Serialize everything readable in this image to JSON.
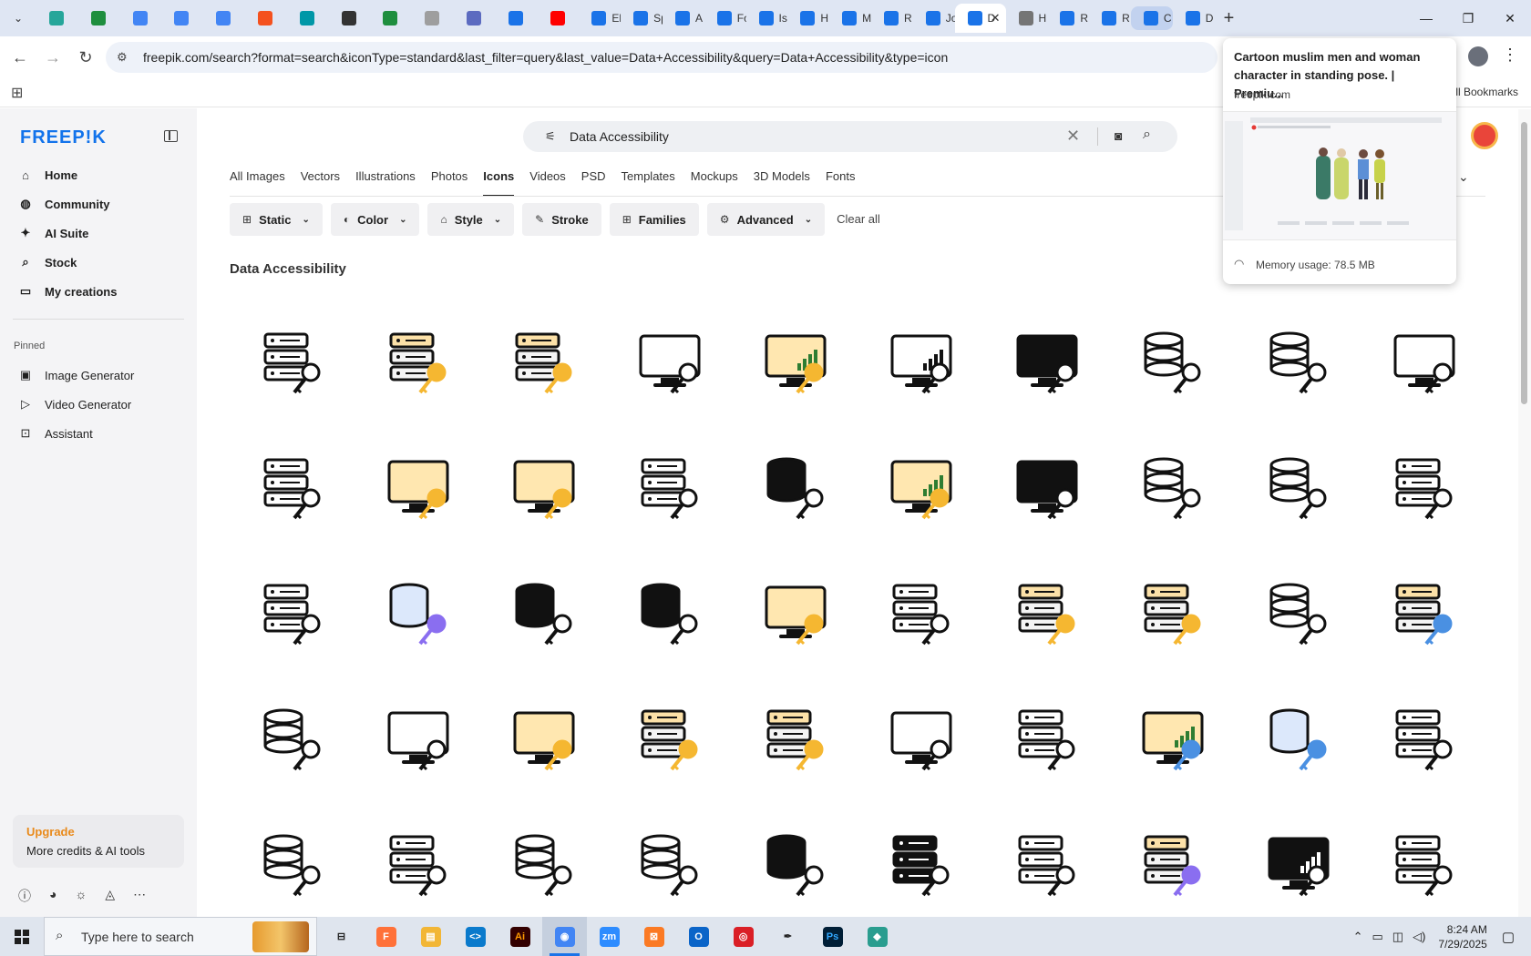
{
  "browser": {
    "tabs": [
      {
        "label": "",
        "color": "#26a69a"
      },
      {
        "label": "",
        "color": "#1e8e3e"
      },
      {
        "label": "",
        "color": "#4285f4"
      },
      {
        "label": "",
        "color": "#4285f4"
      },
      {
        "label": "",
        "color": "#4285f4"
      },
      {
        "label": "",
        "color": "#f4511e"
      },
      {
        "label": "",
        "color": "#0097a7"
      },
      {
        "label": "",
        "color": "#333333"
      },
      {
        "label": "",
        "color": "#1e8e3e"
      },
      {
        "label": "",
        "color": "#9e9e9e"
      },
      {
        "label": "",
        "color": "#5c6bc0"
      },
      {
        "label": "",
        "color": "#1a73e8"
      },
      {
        "label": "",
        "color": "#ff0000"
      },
      {
        "label": "El",
        "color": "#1a73e8"
      },
      {
        "label": "Sp",
        "color": "#1a73e8"
      },
      {
        "label": "A",
        "color": "#1a73e8"
      },
      {
        "label": "Fo",
        "color": "#1a73e8"
      },
      {
        "label": "Is",
        "color": "#1a73e8"
      },
      {
        "label": "H",
        "color": "#1a73e8"
      },
      {
        "label": "M",
        "color": "#1a73e8"
      },
      {
        "label": "R",
        "color": "#1a73e8"
      },
      {
        "label": "Jo",
        "color": "#1a73e8"
      },
      {
        "label": "D",
        "color": "#1a73e8",
        "active": true
      },
      {
        "label": "H",
        "color": "#757575"
      },
      {
        "label": "R",
        "color": "#1a73e8"
      },
      {
        "label": "R",
        "color": "#1a73e8"
      },
      {
        "label": "C",
        "color": "#1a73e8",
        "highlight": true
      },
      {
        "label": "D",
        "color": "#1a73e8"
      }
    ],
    "url": "freepik.com/search?format=search&iconType=standard&last_filter=query&last_value=Data+Accessibility&query=Data+Accessibility&type=icon",
    "all_bookmarks": "All Bookmarks",
    "hover_card": {
      "title": "Cartoon muslim men and woman character in standing pose. | Premiu...",
      "domain": "freepik.com",
      "memory": "Memory usage: 78.5 MB"
    }
  },
  "sidebar": {
    "logo": "FREEP!K",
    "items": [
      {
        "label": "Home",
        "icon": "home-icon",
        "glyph": "⌂"
      },
      {
        "label": "Community",
        "icon": "globe-icon",
        "glyph": "◍"
      },
      {
        "label": "AI Suite",
        "icon": "sparkle-icon",
        "glyph": "✦"
      },
      {
        "label": "Stock",
        "icon": "search-icon",
        "glyph": "⌕"
      },
      {
        "label": "My creations",
        "icon": "folder-icon",
        "glyph": "▭"
      }
    ],
    "pinned_label": "Pinned",
    "pinned": [
      {
        "label": "Image Generator",
        "icon": "image-icon",
        "glyph": "▣"
      },
      {
        "label": "Video Generator",
        "icon": "video-icon",
        "glyph": "▷"
      },
      {
        "label": "Assistant",
        "icon": "chat-icon",
        "glyph": "⊡"
      }
    ],
    "upgrade": {
      "title": "Upgrade",
      "subtitle": "More credits & AI tools"
    }
  },
  "search": {
    "query": "Data Accessibility"
  },
  "type_tabs": [
    {
      "label": "All Images"
    },
    {
      "label": "Vectors"
    },
    {
      "label": "Illustrations"
    },
    {
      "label": "Photos"
    },
    {
      "label": "Icons",
      "active": true
    },
    {
      "label": "Videos"
    },
    {
      "label": "PSD"
    },
    {
      "label": "Templates"
    },
    {
      "label": "Mockups"
    },
    {
      "label": "3D Models"
    },
    {
      "label": "Fonts"
    }
  ],
  "filters": [
    {
      "label": "Static",
      "icon": "static-icon",
      "glyph": "⊞",
      "dropdown": true
    },
    {
      "label": "Color",
      "icon": "color-icon",
      "glyph": "◐",
      "dropdown": true
    },
    {
      "label": "Style",
      "icon": "style-icon",
      "glyph": "⌂",
      "dropdown": true
    },
    {
      "label": "Stroke",
      "icon": "stroke-icon",
      "glyph": "✎",
      "dropdown": false
    },
    {
      "label": "Families",
      "icon": "families-icon",
      "glyph": "⊞",
      "dropdown": false
    },
    {
      "label": "Advanced",
      "icon": "advanced-icon",
      "glyph": "⚙",
      "dropdown": true
    }
  ],
  "clear_all": "Clear all",
  "results_title": "Data Accessibility",
  "icons": [
    "server-key-user",
    "server-key-user-color",
    "server-key-user-flat",
    "folder-key-monitor",
    "monitor-key-chart-color",
    "monitor-key-chart",
    "folder-key-monitor-solid",
    "database-key",
    "database-key-badge",
    "laptop-server-key",
    "server-circuit",
    "laptop-server-key-color",
    "monitor-folder-key-color",
    "server-key-stand",
    "database-key-solid",
    "monitor-key-chart-flat",
    "laptop-cloud-key-solid",
    "database-key-line",
    "database-key-line-2",
    "server-key-user-2",
    "server-network",
    "database-key-gradient",
    "database-key-solid-2",
    "database-key-solid-3",
    "monitor-folder-key-flat",
    "server-key",
    "server-key-badge-color",
    "server-key-network-color",
    "database-key-badge-2",
    "server-key-badge-blue",
    "database-key-2",
    "laptop-cloud-key",
    "laptop-cloud-key-color",
    "cloud-server-key-color",
    "server-circuit-key-color",
    "monitor-fingerprint-key",
    "server-key-badge",
    "monitor-key-chart-blue",
    "database-key-blue",
    "server-key-3",
    "database-key-badge-3",
    "server-list-key",
    "database-key-4",
    "database-key-5",
    "database-key-badge-solid",
    "server-key-solid",
    "server-key-outline",
    "server-key-user-gradient",
    "monitor-chart-key-solid",
    "server-key-window"
  ],
  "taskbar": {
    "search_placeholder": "Type here to search",
    "apps": [
      {
        "name": "task-view",
        "glyph": "⊟",
        "color": "#dfe5ee",
        "fg": "#222"
      },
      {
        "name": "firefox",
        "glyph": "F",
        "color": "#ff7139",
        "fg": "#fff"
      },
      {
        "name": "file-explorer",
        "glyph": "▤",
        "color": "#f2b636",
        "fg": "#fff"
      },
      {
        "name": "vscode",
        "glyph": "<>",
        "color": "#0a7acc",
        "fg": "#fff"
      },
      {
        "name": "illustrator",
        "glyph": "Ai",
        "color": "#330000",
        "fg": "#ff9a00"
      },
      {
        "name": "chrome",
        "glyph": "◉",
        "color": "#4285f4",
        "fg": "#fff",
        "active": true
      },
      {
        "name": "zoom",
        "glyph": "zm",
        "color": "#2d8cff",
        "fg": "#fff"
      },
      {
        "name": "xampp",
        "glyph": "⊠",
        "color": "#fb7a24",
        "fg": "#fff"
      },
      {
        "name": "outlook",
        "glyph": "O",
        "color": "#0a64c8",
        "fg": "#fff"
      },
      {
        "name": "creative-cloud",
        "glyph": "◎",
        "color": "#da1f26",
        "fg": "#fff"
      },
      {
        "name": "inkscape",
        "glyph": "✒",
        "color": "#dfe5ee",
        "fg": "#222"
      },
      {
        "name": "photoshop",
        "glyph": "Ps",
        "color": "#001e36",
        "fg": "#31a8ff"
      },
      {
        "name": "app-diamond",
        "glyph": "◆",
        "color": "#2a9d8f",
        "fg": "#fff"
      }
    ],
    "time": "8:24 AM",
    "date": "7/29/2025"
  }
}
